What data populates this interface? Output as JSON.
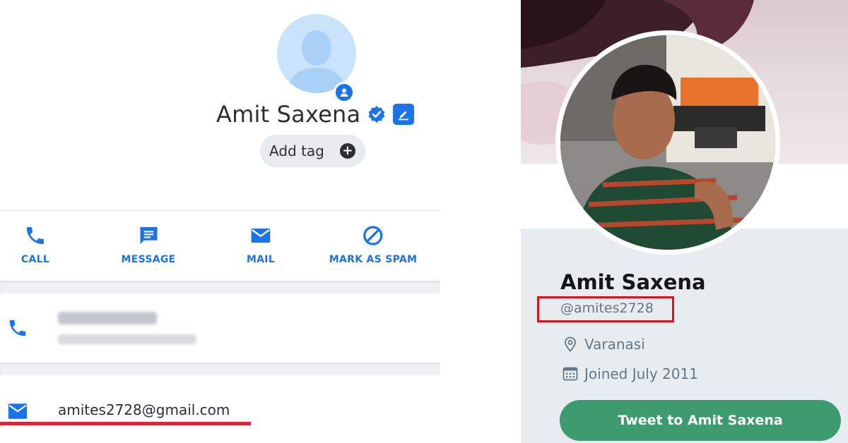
{
  "contact": {
    "name": "Amit Saxena",
    "tag_button": "Add tag",
    "actions": [
      {
        "label": "CALL",
        "icon": "phone-icon"
      },
      {
        "label": "MESSAGE",
        "icon": "message-icon"
      },
      {
        "label": "MAIL",
        "icon": "mail-icon"
      },
      {
        "label": "MARK AS SPAM",
        "icon": "block-icon"
      }
    ],
    "phone_number": "073765 66764",
    "phone_detail": "Mobile · ",
    "email": "amites2728@gmail.com"
  },
  "profile": {
    "name": "Amit Saxena",
    "handle": "@amites2728",
    "location": "Varanasi",
    "joined": "Joined July 2011",
    "tweet_button": "Tweet to Amit Saxena"
  },
  "colors": {
    "accent_blue": "#1a73e8",
    "highlight_red": "#d7263d",
    "tweet_green": "#3d9b6f"
  }
}
